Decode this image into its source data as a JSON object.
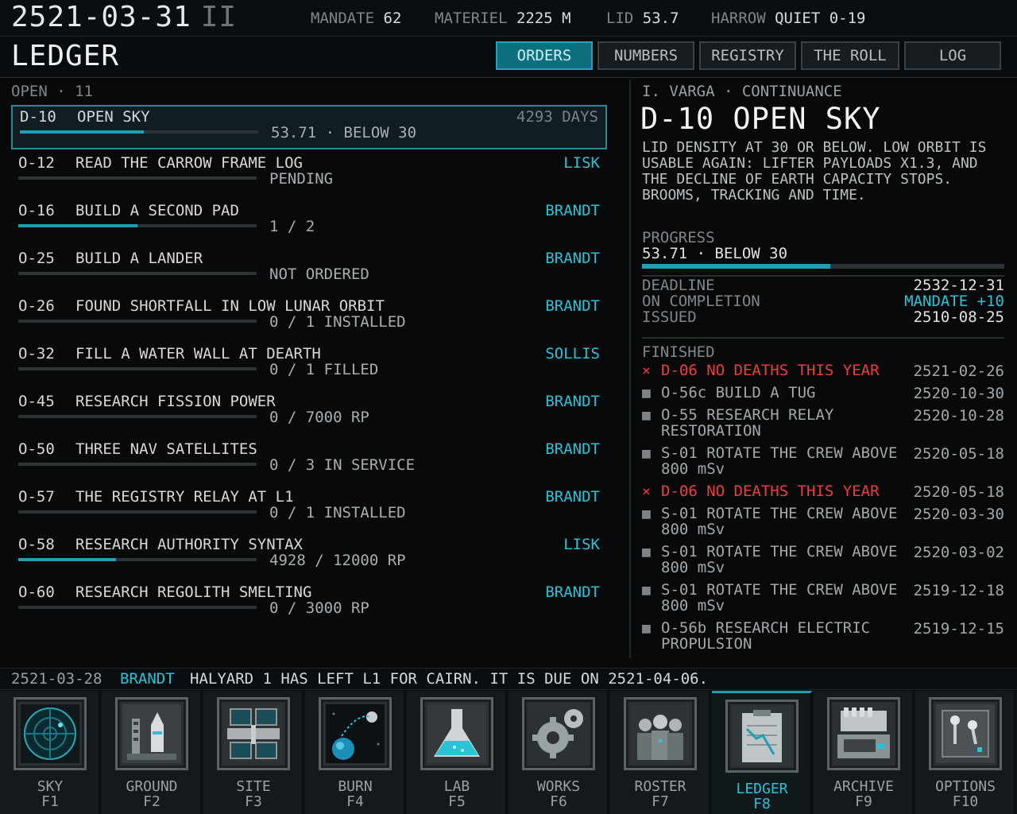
{
  "topbar": {
    "date": "2521-03-31",
    "speed": "II",
    "mandate_label": "MANDATE",
    "mandate_value": "62",
    "materiel_label": "MATERIEL",
    "materiel_value": "2225 M",
    "lid_label": "LID",
    "lid_value": "53.7",
    "harrow_label": "HARROW",
    "harrow_value": "QUIET 0-19"
  },
  "page_title": "LEDGER",
  "tabs": [
    "ORDERS",
    "NUMBERS",
    "REGISTRY",
    "THE ROLL",
    "LOG"
  ],
  "active_tab": "ORDERS",
  "open_count": "OPEN · 11",
  "orders": [
    {
      "code": "D-10",
      "name": "OPEN SKY",
      "assignee": "4293 DAYS",
      "progress_text": "53.71 · BELOW 30",
      "progress": 0.52,
      "selected": true
    },
    {
      "code": "O-12",
      "name": "READ THE CARROW FRAME LOG",
      "assignee": "LISK",
      "progress_text": "PENDING",
      "progress": 0
    },
    {
      "code": "O-16",
      "name": "BUILD A SECOND PAD",
      "assignee": "BRANDT",
      "progress_text": "1 / 2",
      "progress": 0.5
    },
    {
      "code": "O-25",
      "name": "BUILD A LANDER",
      "assignee": "BRANDT",
      "progress_text": "NOT ORDERED",
      "progress": 0
    },
    {
      "code": "O-26",
      "name": "FOUND SHORTFALL IN LOW LUNAR ORBIT",
      "assignee": "BRANDT",
      "progress_text": "0 / 1 INSTALLED",
      "progress": 0
    },
    {
      "code": "O-32",
      "name": "FILL A WATER WALL AT DEARTH",
      "assignee": "SOLLIS",
      "progress_text": "0 / 1 FILLED",
      "progress": 0
    },
    {
      "code": "O-45",
      "name": "RESEARCH FISSION POWER",
      "assignee": "BRANDT",
      "progress_text": "0 / 7000 RP",
      "progress": 0
    },
    {
      "code": "O-50",
      "name": "THREE NAV SATELLITES",
      "assignee": "BRANDT",
      "progress_text": "0 / 3 IN SERVICE",
      "progress": 0
    },
    {
      "code": "O-57",
      "name": "THE REGISTRY RELAY AT L1",
      "assignee": "BRANDT",
      "progress_text": "0 / 1 INSTALLED",
      "progress": 0
    },
    {
      "code": "O-58",
      "name": "RESEARCH AUTHORITY SYNTAX",
      "assignee": "LISK",
      "progress_text": "4928 / 12000 RP",
      "progress": 0.41
    },
    {
      "code": "O-60",
      "name": "RESEARCH REGOLITH SMELTING",
      "assignee": "BRANDT",
      "progress_text": "0 / 3000 RP",
      "progress": 0
    }
  ],
  "detail": {
    "issuer": "I. VARGA · CONTINUANCE",
    "title": "D-10 OPEN SKY",
    "description": "LID DENSITY AT 30 OR BELOW. LOW ORBIT IS USABLE AGAIN: LIFTER PAYLOADS X1.3, AND THE DECLINE OF EARTH CAPACITY STOPS. BROOMS, TRACKING AND TIME.",
    "progress_label": "PROGRESS",
    "progress_text": "53.71 · BELOW 30",
    "progress": 0.52,
    "deadline_label": "DEADLINE",
    "deadline_value": "2532-12-31",
    "completion_label": "ON COMPLETION",
    "completion_value": "MANDATE +10",
    "issued_label": "ISSUED",
    "issued_value": "2510-08-25",
    "finished_label": "FINISHED",
    "finished": [
      {
        "mark": "×",
        "text": "D-06 NO DEATHS THIS YEAR",
        "date": "2521-02-26",
        "failed": true
      },
      {
        "mark": "■",
        "text": "O-56c BUILD A TUG",
        "date": "2520-10-30",
        "failed": false
      },
      {
        "mark": "■",
        "text": "O-55 RESEARCH RELAY RESTORATION",
        "date": "2520-10-28",
        "failed": false
      },
      {
        "mark": "■",
        "text": "S-01 ROTATE THE CREW ABOVE 800 mSv",
        "date": "2520-05-18",
        "failed": false
      },
      {
        "mark": "×",
        "text": "D-06 NO DEATHS THIS YEAR",
        "date": "2520-05-18",
        "failed": true
      },
      {
        "mark": "■",
        "text": "S-01 ROTATE THE CREW ABOVE 800 mSv",
        "date": "2520-03-30",
        "failed": false
      },
      {
        "mark": "■",
        "text": "S-01 ROTATE THE CREW ABOVE 800 mSv",
        "date": "2520-03-02",
        "failed": false
      },
      {
        "mark": "■",
        "text": "S-01 ROTATE THE CREW ABOVE 800 mSv",
        "date": "2519-12-18",
        "failed": false
      },
      {
        "mark": "■",
        "text": "O-56b RESEARCH ELECTRIC PROPULSION",
        "date": "2519-12-15",
        "failed": false
      }
    ]
  },
  "status": {
    "date": "2521-03-28",
    "who": "BRANDT",
    "message": "HALYARD 1 HAS LEFT L1 FOR CAIRN. IT IS DUE ON 2521-04-06."
  },
  "nav": [
    {
      "label": "SKY",
      "key": "F1",
      "icon": "radar-icon"
    },
    {
      "label": "GROUND",
      "key": "F2",
      "icon": "launch-pad-icon"
    },
    {
      "label": "SITE",
      "key": "F3",
      "icon": "station-icon"
    },
    {
      "label": "BURN",
      "key": "F4",
      "icon": "orbit-icon"
    },
    {
      "label": "LAB",
      "key": "F5",
      "icon": "flask-icon"
    },
    {
      "label": "WORKS",
      "key": "F6",
      "icon": "gears-icon"
    },
    {
      "label": "ROSTER",
      "key": "F7",
      "icon": "crew-icon"
    },
    {
      "label": "LEDGER",
      "key": "F8",
      "icon": "clipboard-chart-icon"
    },
    {
      "label": "ARCHIVE",
      "key": "F9",
      "icon": "archive-machine-icon"
    },
    {
      "label": "OPTIONS",
      "key": "F10",
      "icon": "switches-icon"
    }
  ],
  "active_nav": "LEDGER",
  "colors": {
    "accent": "#2ac3d6",
    "fail": "#ef3b3b",
    "bar": "#1f9fb1"
  }
}
